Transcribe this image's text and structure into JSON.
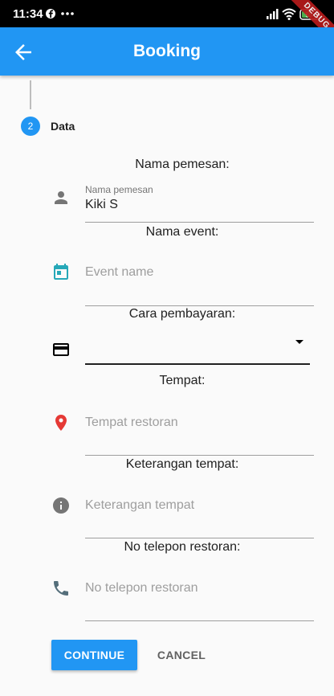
{
  "status_bar": {
    "time": "11:34",
    "battery": "53",
    "debug_label": "DEBUG",
    "icons": [
      "facebook-icon",
      "more-dots-icon",
      "signal-icon",
      "wifi-icon",
      "battery-icon"
    ]
  },
  "app_bar": {
    "title": "Booking",
    "back_icon": "arrow-back-icon",
    "color": "#2196f3"
  },
  "stepper": {
    "step_number": "2",
    "step_label": "Data"
  },
  "form": {
    "nama_pemesan": {
      "section_title": "Nama pemesan:",
      "label": "Nama pemesan",
      "value": "Kiki S",
      "icon": "person-icon"
    },
    "nama_event": {
      "section_title": "Nama event:",
      "placeholder": "Event name",
      "icon": "calendar-icon"
    },
    "cara_pembayaran": {
      "section_title": "Cara pembayaran:",
      "selected": "",
      "icon": "credit-card-icon"
    },
    "tempat": {
      "section_title": "Tempat:",
      "placeholder": "Tempat restoran",
      "icon": "location-pin-icon"
    },
    "keterangan_tempat": {
      "section_title": "Keterangan tempat:",
      "placeholder": "Keterangan tempat",
      "icon": "info-icon"
    },
    "no_telepon": {
      "section_title": "No telepon restoran:",
      "placeholder": "No telepon restoran",
      "icon": "phone-icon"
    }
  },
  "actions": {
    "continue_label": "CONTINUE",
    "cancel_label": "CANCEL"
  },
  "colors": {
    "primary": "#2196f3",
    "calendar": "#26a8b8",
    "location": "#e53935",
    "phone": "#546e7a"
  }
}
